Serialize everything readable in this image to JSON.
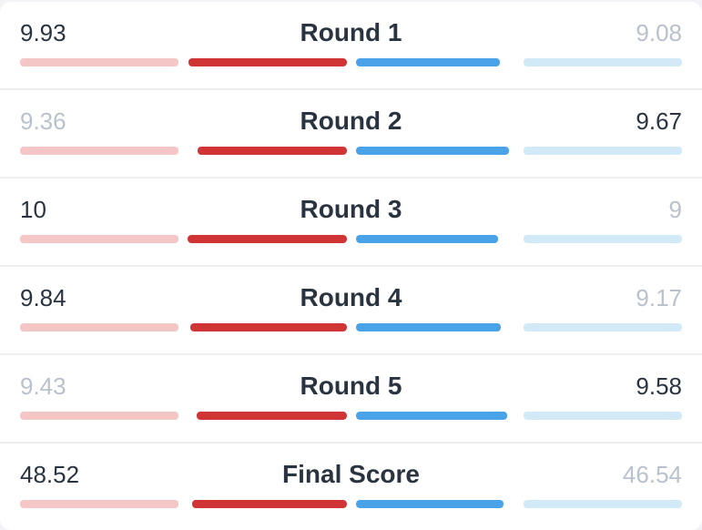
{
  "colors": {
    "red_strong": "#d13434",
    "red_weak": "#f5c6c6",
    "blue_strong": "#4aa3e8",
    "blue_weak": "#d2e9f7",
    "text_strong": "#2a3440",
    "text_muted": "#b9c2cc"
  },
  "max_round_score": 10,
  "max_final_score": 50,
  "rows": [
    {
      "label": "Round 1",
      "left": 9.93,
      "right": 9.08,
      "left_display": "9.93",
      "right_display": "9.08",
      "winner": "left"
    },
    {
      "label": "Round 2",
      "left": 9.36,
      "right": 9.67,
      "left_display": "9.36",
      "right_display": "9.67",
      "winner": "right"
    },
    {
      "label": "Round 3",
      "left": 10,
      "right": 9,
      "left_display": "10",
      "right_display": "9",
      "winner": "left"
    },
    {
      "label": "Round 4",
      "left": 9.84,
      "right": 9.17,
      "left_display": "9.84",
      "right_display": "9.17",
      "winner": "left"
    },
    {
      "label": "Round 5",
      "left": 9.43,
      "right": 9.58,
      "left_display": "9.43",
      "right_display": "9.58",
      "winner": "right"
    },
    {
      "label": "Final Score",
      "left": 48.52,
      "right": 46.54,
      "left_display": "48.52",
      "right_display": "46.54",
      "winner": "left",
      "final": true
    }
  ],
  "chart_data": {
    "type": "bar",
    "title": "",
    "categories": [
      "Round 1",
      "Round 2",
      "Round 3",
      "Round 4",
      "Round 5",
      "Final Score"
    ],
    "series": [
      {
        "name": "Left (Red)",
        "values": [
          9.93,
          9.36,
          10,
          9.84,
          9.43,
          48.52
        ]
      },
      {
        "name": "Right (Blue)",
        "values": [
          9.08,
          9.67,
          9,
          9.17,
          9.58,
          46.54
        ]
      }
    ],
    "ylim_round": [
      0,
      10
    ],
    "ylim_final": [
      0,
      50
    ],
    "xlabel": "",
    "ylabel": ""
  }
}
